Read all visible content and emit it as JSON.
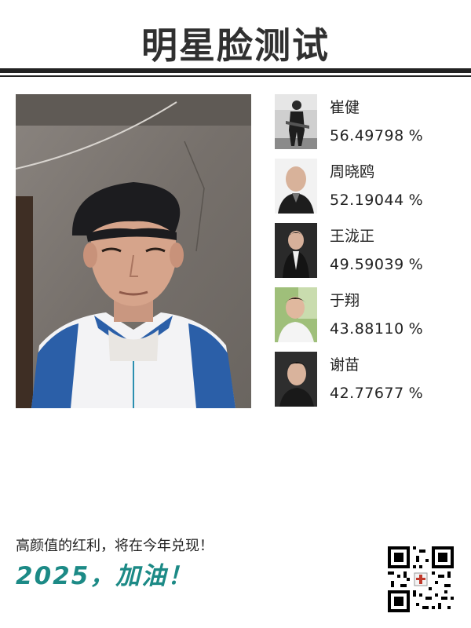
{
  "header": {
    "title": "明星脸测试"
  },
  "results": [
    {
      "name": "崔健",
      "score": "56.49798",
      "unit": "%"
    },
    {
      "name": "周晓鸥",
      "score": "52.19044",
      "unit": "%"
    },
    {
      "name": "王泷正",
      "score": "49.59039",
      "unit": "%"
    },
    {
      "name": "于翔",
      "score": "43.88110",
      "unit": "%"
    },
    {
      "name": "谢苗",
      "score": "42.77677",
      "unit": "%"
    }
  ],
  "footer": {
    "line1": "高颜值的红利，将在今年兑现！",
    "line2": "2025，加油！"
  },
  "colors": {
    "accent": "#1c8a86",
    "text": "#222222",
    "rule": "#222222"
  },
  "icons": {
    "qr": "qr-code-icon"
  }
}
